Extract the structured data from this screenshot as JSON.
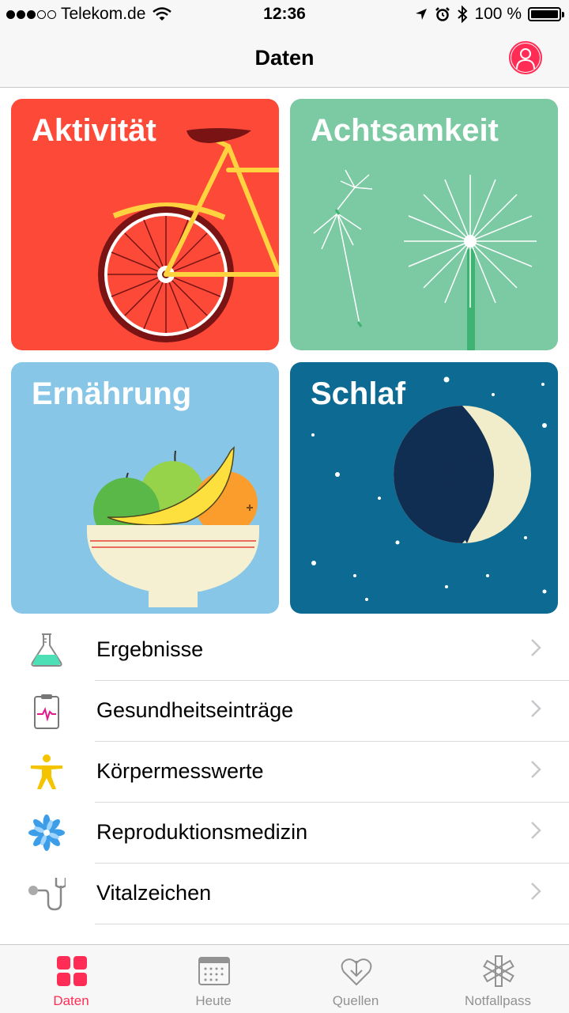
{
  "status_bar": {
    "carrier": "Telekom.de",
    "time": "12:36",
    "battery": "100 %"
  },
  "nav": {
    "title": "Daten"
  },
  "tiles": [
    {
      "title": "Aktivität",
      "color": "#fd4a38"
    },
    {
      "title": "Achtsamkeit",
      "color": "#7bcaa3"
    },
    {
      "title": "Ernährung",
      "color": "#87c6e6"
    },
    {
      "title": "Schlaf",
      "color": "#0d6a93"
    }
  ],
  "list": [
    {
      "label": "Ergebnisse",
      "icon": "flask-icon"
    },
    {
      "label": "Gesundheitseinträge",
      "icon": "clipboard-ecg-icon"
    },
    {
      "label": "Körpermesswerte",
      "icon": "body-figure-icon"
    },
    {
      "label": "Reproduktionsmedizin",
      "icon": "flower-icon"
    },
    {
      "label": "Vitalzeichen",
      "icon": "stethoscope-icon"
    }
  ],
  "tabs": [
    {
      "label": "Daten",
      "icon": "grid-icon",
      "active": true
    },
    {
      "label": "Heute",
      "icon": "calendar-icon",
      "active": false
    },
    {
      "label": "Quellen",
      "icon": "heart-download-icon",
      "active": false
    },
    {
      "label": "Notfallpass",
      "icon": "medical-star-icon",
      "active": false
    }
  ],
  "colors": {
    "accent": "#ff2d55",
    "inactive_tab": "#929292"
  }
}
